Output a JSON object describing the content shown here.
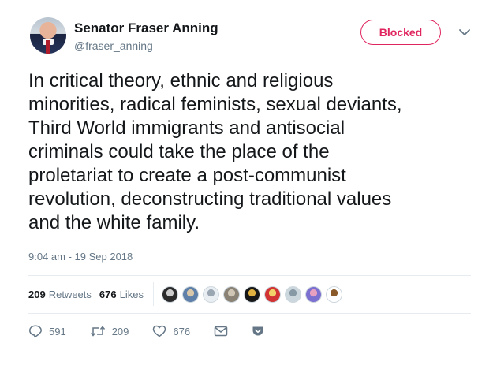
{
  "author": {
    "name": "Senator Fraser Anning",
    "handle": "@fraser_anning"
  },
  "follow_state": {
    "label": "Blocked"
  },
  "tweet": {
    "text": "In critical theory, ethnic and religious\nminorities, radical feminists, sexual deviants,\nThird World immigrants and antisocial\ncriminals could take the place of the\nproletariat to create a post-communist\nrevolution, deconstructing traditional values\nand the white family.",
    "timestamp": "9:04 am - 19 Sep 2018"
  },
  "stats": {
    "retweets_count": "209",
    "retweets_label": "Retweets",
    "likes_count": "676",
    "likes_label": "Likes"
  },
  "actions": {
    "reply_count": "591",
    "retweet_count": "209",
    "like_count": "676"
  },
  "colors": {
    "accent_red": "#e0245e",
    "secondary_text": "#657786",
    "border": "#e6ecf0"
  },
  "liker_avatars": [
    {
      "icon": "avatar-dark-pattern",
      "bg": "#2b2b2b",
      "fg": "#cccccc"
    },
    {
      "icon": "avatar-landscape",
      "bg": "#5d7fa8",
      "fg": "#d8c7a8"
    },
    {
      "icon": "avatar-light-pattern",
      "bg": "#e9eef2",
      "fg": "#9aa6b2"
    },
    {
      "icon": "avatar-coin",
      "bg": "#8a8275",
      "fg": "#cfc6b5"
    },
    {
      "icon": "avatar-dark-face",
      "bg": "#171717",
      "fg": "#e0b040"
    },
    {
      "icon": "avatar-red-cap",
      "bg": "#d23434",
      "fg": "#f1d36a"
    },
    {
      "icon": "avatar-default",
      "bg": "#ccd6dd",
      "fg": "#8899a6"
    },
    {
      "icon": "avatar-cartoon",
      "bg": "#7b6fd0",
      "fg": "#e8a0c0"
    },
    {
      "icon": "avatar-cowboy",
      "bg": "#ffffff",
      "fg": "#8a5a2b"
    }
  ]
}
